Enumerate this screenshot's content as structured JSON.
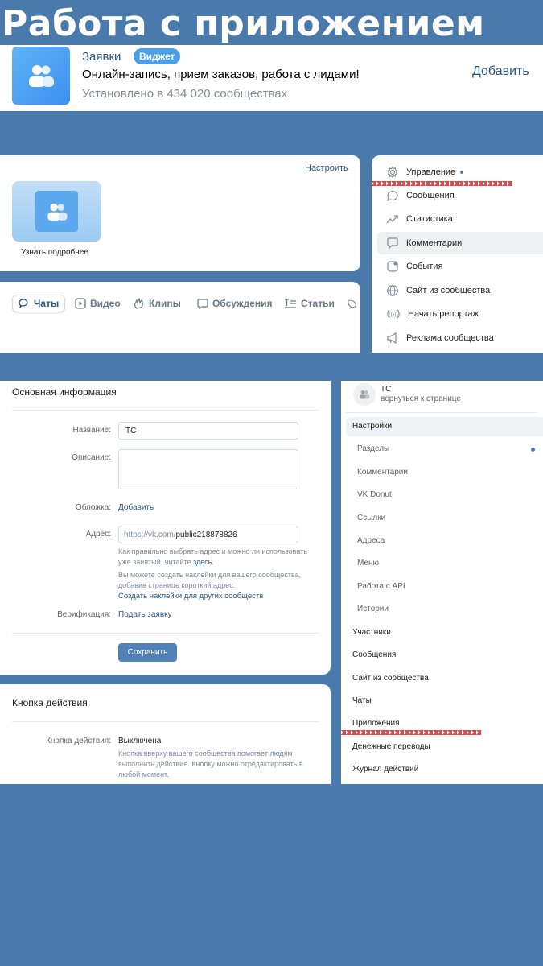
{
  "headline": "Работа с приложением",
  "app": {
    "name": "Заявки",
    "badge": "Виджет",
    "description": "Онлайн-запись, прием заказов, работа с лидами!",
    "installed": "Установлено в 434 020 сообществах",
    "add_label": "Добавить"
  },
  "widgets": {
    "configure_label": "Настроить",
    "learn_more": "Узнать подробнее"
  },
  "tabs": [
    {
      "label": "Чаты"
    },
    {
      "label": "Видео"
    },
    {
      "label": "Клипы"
    },
    {
      "label": "Обсуждения"
    },
    {
      "label": "Статьи"
    }
  ],
  "menu": [
    {
      "label": "Управление",
      "icon": "gear-icon"
    },
    {
      "label": "Сообщения",
      "icon": "chat-icon"
    },
    {
      "label": "Статистика",
      "icon": "chart-icon"
    },
    {
      "label": "Комментарии",
      "icon": "comment-icon"
    },
    {
      "label": "События",
      "icon": "event-icon"
    },
    {
      "label": "Сайт из сообщества",
      "icon": "globe-icon"
    },
    {
      "label": "Начать репортаж",
      "icon": "broadcast-icon"
    },
    {
      "label": "Реклама сообщества",
      "icon": "megaphone-icon"
    }
  ],
  "form": {
    "section_title": "Основная информация",
    "name_label": "Название:",
    "name_value": "ТС",
    "desc_label": "Описание:",
    "cover_label": "Обложка:",
    "cover_action": "Добавить",
    "address_label": "Адрес:",
    "address_prefix": "https://vk.com/",
    "address_value": "public218878826",
    "address_hint": "Как правильно выбрать адрес и можно ли использовать уже занятый, читайте",
    "address_hint_link": "здесь",
    "sticker_hint": "Вы можете создать наклейки для вашего сообщества, добавив странице короткий адрес.",
    "sticker_link": "Создать наклейки для других сообществ",
    "verification_label": "Верификация:",
    "verification_action": "Подать заявку",
    "save": "Сохранить"
  },
  "action_button": {
    "section_title": "Кнопка действия",
    "label": "Кнопка действия:",
    "value": "Выключена",
    "hint": "Кнопка вверху вашего сообщества помогает людям выполнить действие. Кнопку можно отредактировать в любой момент."
  },
  "community": {
    "name": "ТС",
    "back": "вернуться к странице"
  },
  "settings_menu": [
    {
      "label": "Настройки",
      "sub": false
    },
    {
      "label": "Разделы",
      "sub": true
    },
    {
      "label": "Комментарии",
      "sub": true
    },
    {
      "label": "VK Donut",
      "sub": true
    },
    {
      "label": "Ссылки",
      "sub": true
    },
    {
      "label": "Адреса",
      "sub": true
    },
    {
      "label": "Меню",
      "sub": true
    },
    {
      "label": "Работа с API",
      "sub": true
    },
    {
      "label": "Истории",
      "sub": true
    },
    {
      "label": "Участники",
      "sub": false
    },
    {
      "label": "Сообщения",
      "sub": false
    },
    {
      "label": "Сайт из сообщества",
      "sub": false
    },
    {
      "label": "Чаты",
      "sub": false
    },
    {
      "label": "Приложения",
      "sub": false
    },
    {
      "label": "Денежные переводы",
      "sub": false
    },
    {
      "label": "Журнал действий",
      "sub": false
    }
  ],
  "colors": {
    "background": "#4a7aab",
    "accent": "#5181b8",
    "link": "#2a5885",
    "annotation": "#e04848"
  }
}
